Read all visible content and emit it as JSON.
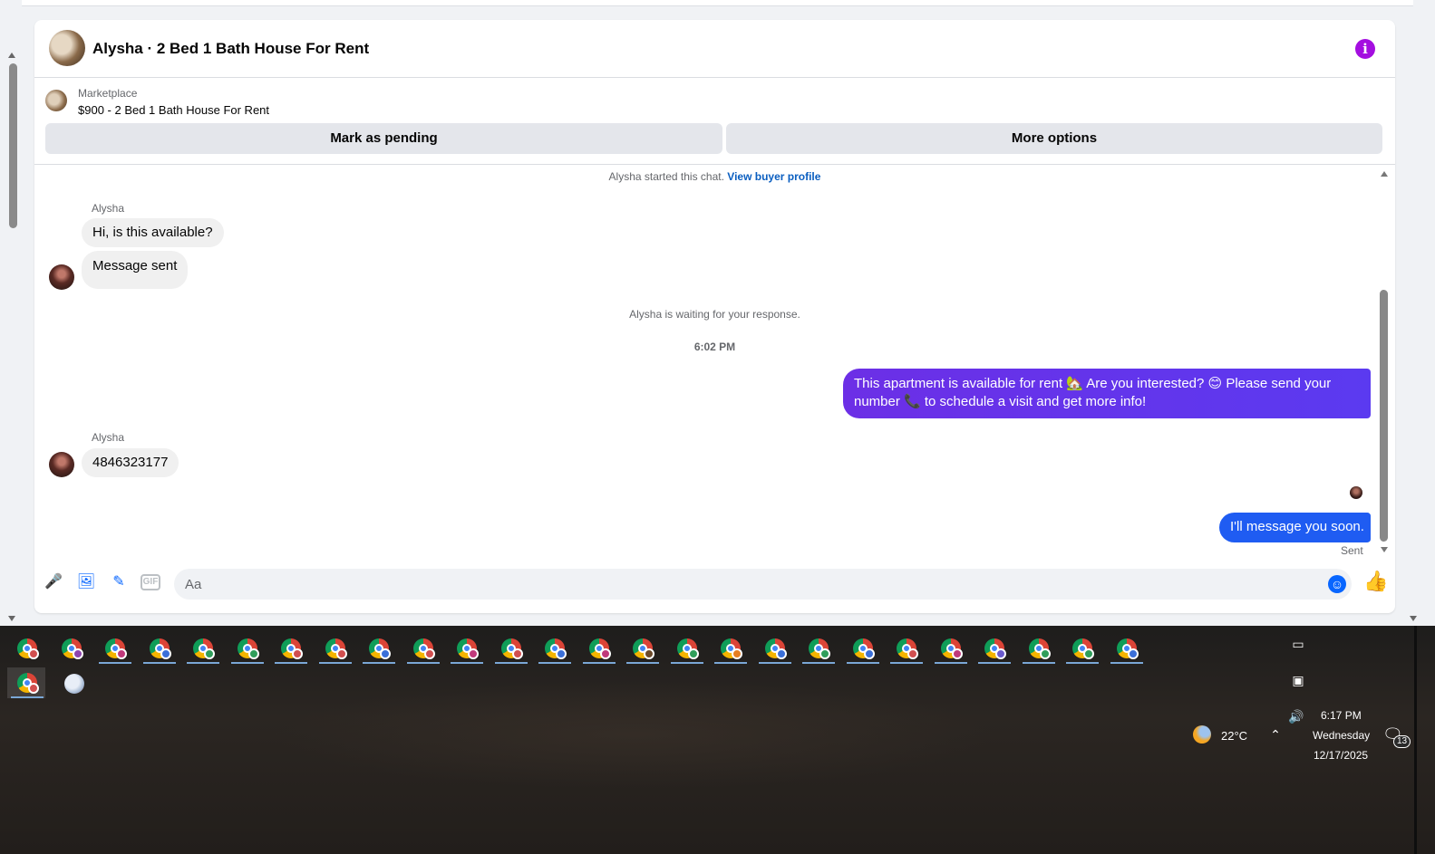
{
  "header": {
    "title": "Alysha · 2 Bed 1 Bath House For Rent",
    "info_icon": "info-icon",
    "accent_color": "#a40ee0"
  },
  "listing": {
    "category": "Marketplace",
    "price_title": "$900 - 2 Bed 1 Bath House For Rent",
    "mark_pending_label": "Mark as pending",
    "more_options_label": "More options"
  },
  "chat": {
    "started_text": "Alysha started this chat.",
    "view_profile_link": "View buyer profile",
    "sender_name_1": "Alysha",
    "msg_1": "Hi, is this available?",
    "msg_2": "Message sent",
    "waiting_text": "Alysha is waiting for your response.",
    "timestamp": "6:02 PM",
    "out_msg_1": "This apartment is available for rent 🏡 Are you interested? 😊 Please send your number 📞 to schedule a visit and get more info!",
    "sender_name_2": "Alysha",
    "msg_3": "4846323177",
    "out_msg_2": "I'll message you soon.",
    "sent_status": "Sent",
    "out_color_1": "#6c2fe6",
    "out_color_2": "#1f5cf2"
  },
  "composer": {
    "placeholder": "Aa",
    "icons": [
      "mic-icon",
      "photo-icon",
      "sticker-icon",
      "gif-icon",
      "emoji-icon",
      "like-icon"
    ],
    "gif_label": "GIF"
  },
  "taskbar": {
    "pinned_count": 26,
    "weather_temp": "22°C",
    "time": "6:17 PM",
    "day": "Wednesday",
    "date": "12/17/2025",
    "notification_count": "13"
  }
}
